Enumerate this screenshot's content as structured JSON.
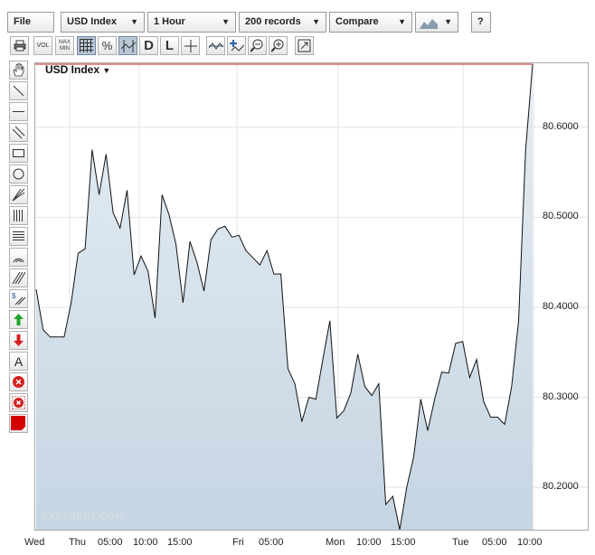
{
  "toolbar": {
    "file_label": "File",
    "symbol_label": "USD Index",
    "interval_label": "1 Hour",
    "records_label": "200 records",
    "compare_label": "Compare",
    "help_label": "?"
  },
  "toolbar2": {
    "vol_label": "VOL",
    "maxmin_label": "MAX\nMIN",
    "percent_label": "%",
    "d_label": "D",
    "l_label": "L"
  },
  "chart_title": "USD Index",
  "watermark": "FXSTREET.COM",
  "colors": {
    "line": "#111111",
    "fill_top": "#e6eef5",
    "fill_bottom": "#c5d5e2",
    "last_line": "#cc2222"
  },
  "chart_data": {
    "type": "area",
    "xlabels": [
      "Wed",
      "Thu",
      "05:00",
      "10:00",
      "15:00",
      "Fri",
      "05:00",
      "Mon",
      "10:00",
      "15:00",
      "Tue",
      "05:00",
      "10:00"
    ],
    "yticks": [
      "80.6000",
      "80.5000",
      "80.4000",
      "80.3000",
      "80.2000"
    ],
    "ytick_values": [
      80.6,
      80.5,
      80.4,
      80.3,
      80.2
    ],
    "ylim": [
      80.153,
      80.67
    ],
    "values": [
      80.42,
      80.375,
      80.367,
      80.367,
      80.367,
      80.405,
      80.46,
      80.465,
      80.575,
      80.525,
      80.57,
      80.505,
      80.488,
      80.53,
      80.436,
      80.457,
      80.44,
      80.388,
      80.525,
      80.503,
      80.47,
      80.405,
      80.473,
      80.45,
      80.418,
      80.475,
      80.487,
      80.49,
      80.478,
      80.48,
      80.463,
      80.455,
      80.447,
      80.463,
      80.437,
      80.437,
      80.332,
      80.315,
      80.273,
      80.3,
      80.298,
      80.342,
      80.385,
      80.277,
      80.285,
      80.305,
      80.348,
      80.312,
      80.302,
      80.315,
      80.181,
      80.19,
      80.153,
      80.2,
      80.234,
      80.298,
      80.263,
      80.298,
      80.328,
      80.327,
      80.36,
      80.362,
      80.322,
      80.342,
      80.295,
      80.278,
      80.278,
      80.27,
      80.312,
      80.385,
      80.575,
      80.67
    ],
    "grid": true,
    "legend": "none"
  }
}
